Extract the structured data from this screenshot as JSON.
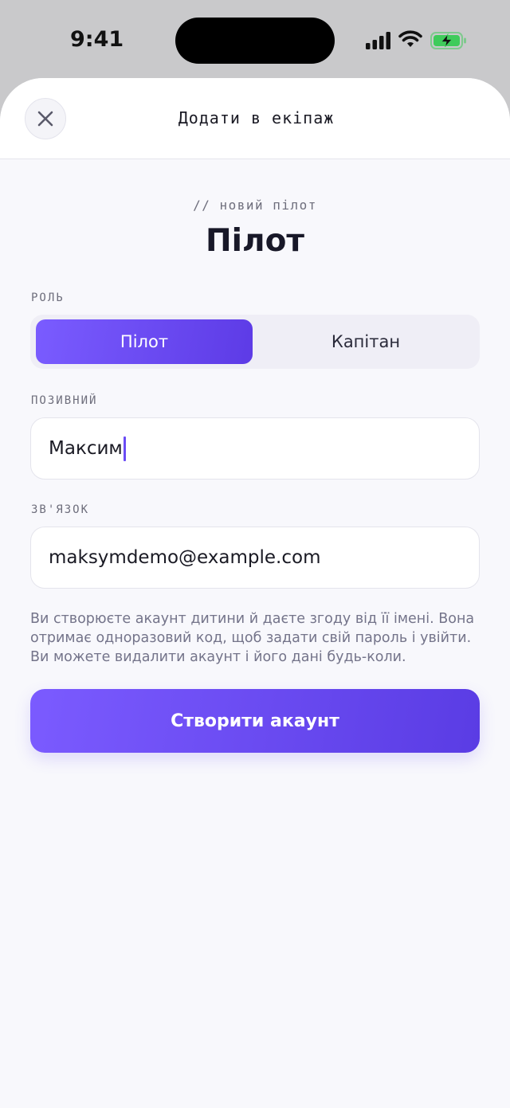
{
  "status_bar": {
    "time": "9:41"
  },
  "header": {
    "title": "Додати в екіпаж"
  },
  "eyebrow": "// новий пілот",
  "page_title": "Пілот",
  "role": {
    "label": "РОЛЬ",
    "options": [
      "Пілот",
      "Капітан"
    ],
    "selected": "Пілот"
  },
  "callsign": {
    "label": "ПОЗИВНИЙ",
    "value": "Максим"
  },
  "contact": {
    "label": "ЗВ'ЯЗОК",
    "value": "maksymdemo@example.com"
  },
  "notice": "Ви створюєте акаунт дитини й даєте згоду від її імені. Вона отримає одноразовий код, щоб задати свій пароль і увійти. Ви можете видалити акаунт і його дані будь-коли.",
  "primary_button": "Створити акаунт",
  "colors": {
    "accent": "#6a4cf5",
    "battery": "#3fcb5b"
  }
}
